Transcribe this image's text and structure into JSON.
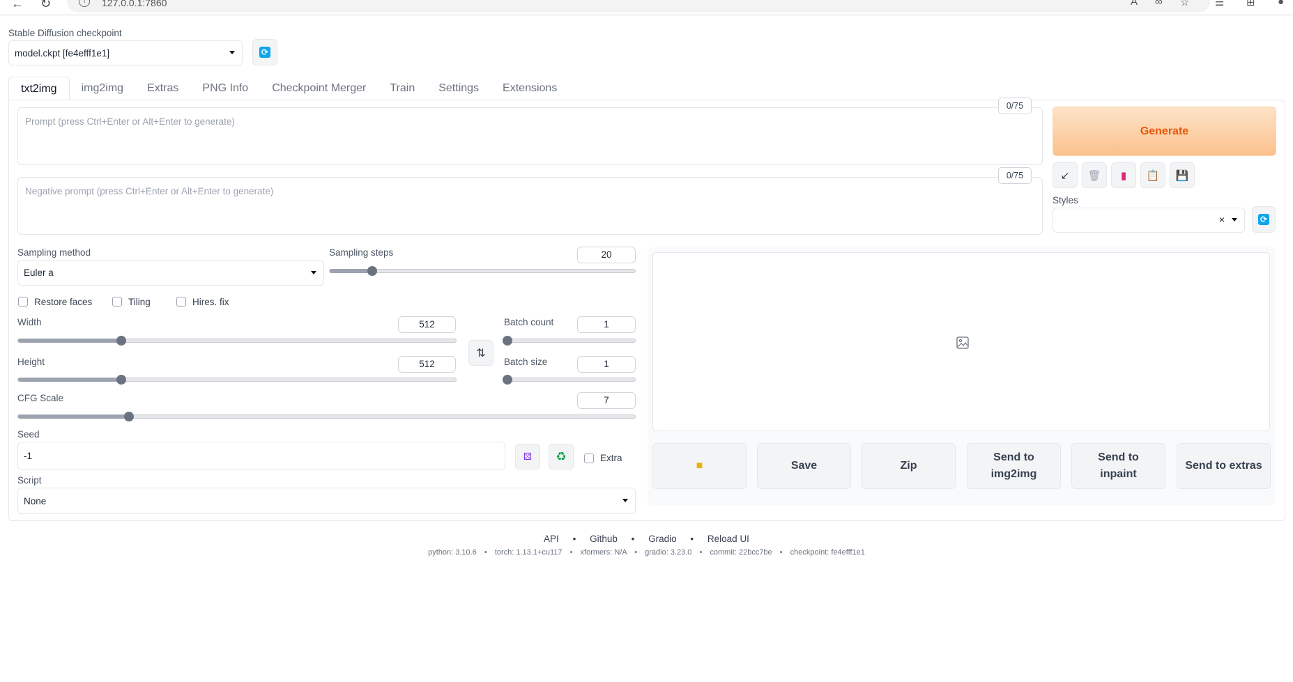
{
  "browser": {
    "url": "127.0.0.1:7860"
  },
  "checkpoint": {
    "label": "Stable Diffusion checkpoint",
    "value": "model.ckpt [fe4efff1e1]"
  },
  "tabs": [
    {
      "label": "txt2img"
    },
    {
      "label": "img2img"
    },
    {
      "label": "Extras"
    },
    {
      "label": "PNG Info"
    },
    {
      "label": "Checkpoint Merger"
    },
    {
      "label": "Train"
    },
    {
      "label": "Settings"
    },
    {
      "label": "Extensions"
    }
  ],
  "prompt": {
    "placeholder": "Prompt (press Ctrl+Enter or Alt+Enter to generate)",
    "counter": "0/75"
  },
  "negative_prompt": {
    "placeholder": "Negative prompt (press Ctrl+Enter or Alt+Enter to generate)",
    "counter": "0/75"
  },
  "generate_label": "Generate",
  "styles": {
    "label": "Styles",
    "clear": "×"
  },
  "sampling": {
    "method_label": "Sampling method",
    "method_value": "Euler a",
    "steps_label": "Sampling steps",
    "steps_value": "20"
  },
  "checkboxes": {
    "restore_faces": "Restore faces",
    "tiling": "Tiling",
    "hires_fix": "Hires. fix"
  },
  "width": {
    "label": "Width",
    "value": "512"
  },
  "height": {
    "label": "Height",
    "value": "512"
  },
  "batch_count": {
    "label": "Batch count",
    "value": "1"
  },
  "batch_size": {
    "label": "Batch size",
    "value": "1"
  },
  "cfg": {
    "label": "CFG Scale",
    "value": "7"
  },
  "seed": {
    "label": "Seed",
    "value": "-1",
    "extra_label": "Extra"
  },
  "script": {
    "label": "Script",
    "value": "None"
  },
  "output_buttons": {
    "save": "Save",
    "zip": "Zip",
    "send_img2img": "Send to img2img",
    "send_inpaint": "Send to inpaint",
    "send_extras": "Send to extras"
  },
  "footer": {
    "links": [
      "API",
      "Github",
      "Gradio",
      "Reload UI"
    ],
    "versions": [
      "python: 3.10.6",
      "torch: 1.13.1+cu117",
      "xformers: N/A",
      "gradio: 3.23.0",
      "commit: 22bcc7be",
      "checkpoint: fe4efff1e1"
    ],
    "separator": "•"
  }
}
